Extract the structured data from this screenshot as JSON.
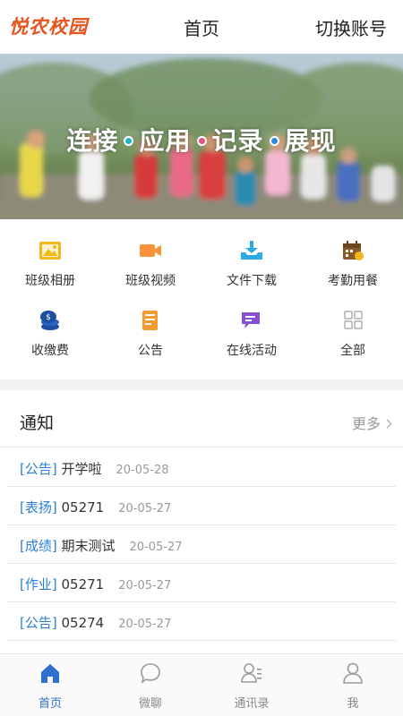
{
  "header": {
    "logo": "悦农校园",
    "title": "首页",
    "switch_account": "切换账号"
  },
  "banner": {
    "slogan": [
      "连接",
      "应用",
      "记录",
      "展现"
    ]
  },
  "grid": [
    {
      "label": "班级相册",
      "icon": "photo-album-icon",
      "color": "#f4b81d"
    },
    {
      "label": "班级视频",
      "icon": "video-camera-icon",
      "color": "#f7943a"
    },
    {
      "label": "文件下载",
      "icon": "download-tray-icon",
      "color": "#2ea9e6"
    },
    {
      "label": "考勤用餐",
      "icon": "calendar-icon",
      "color": "#8b5a2b"
    },
    {
      "label": "收缴费",
      "icon": "coin-stack-icon",
      "color": "#1c4fa0"
    },
    {
      "label": "公告",
      "icon": "notice-document-icon",
      "color": "#f39a33"
    },
    {
      "label": "在线活动",
      "icon": "chat-activity-icon",
      "color": "#8a4fd1"
    },
    {
      "label": "全部",
      "icon": "grid-all-icon",
      "color": "#b0b0b0"
    }
  ],
  "notice": {
    "title": "通知",
    "more": "更多",
    "items": [
      {
        "tag": "[公告]",
        "text": "开学啦",
        "date": "20-05-28"
      },
      {
        "tag": "[表扬]",
        "text": "05271",
        "date": "20-05-27"
      },
      {
        "tag": "[成绩]",
        "text": "期末测试",
        "date": "20-05-27"
      },
      {
        "tag": "[作业]",
        "text": "05271",
        "date": "20-05-27"
      },
      {
        "tag": "[公告]",
        "text": "05274",
        "date": "20-05-27"
      }
    ]
  },
  "tabbar": {
    "tabs": [
      {
        "label": "首页",
        "icon": "home-icon",
        "active": true
      },
      {
        "label": "微聊",
        "icon": "chat-bubble-icon",
        "active": false
      },
      {
        "label": "通讯录",
        "icon": "contacts-icon",
        "active": false
      },
      {
        "label": "我",
        "icon": "user-icon",
        "active": false
      }
    ],
    "active_color": "#2f6fcf",
    "inactive_color": "#9a9a9a"
  }
}
